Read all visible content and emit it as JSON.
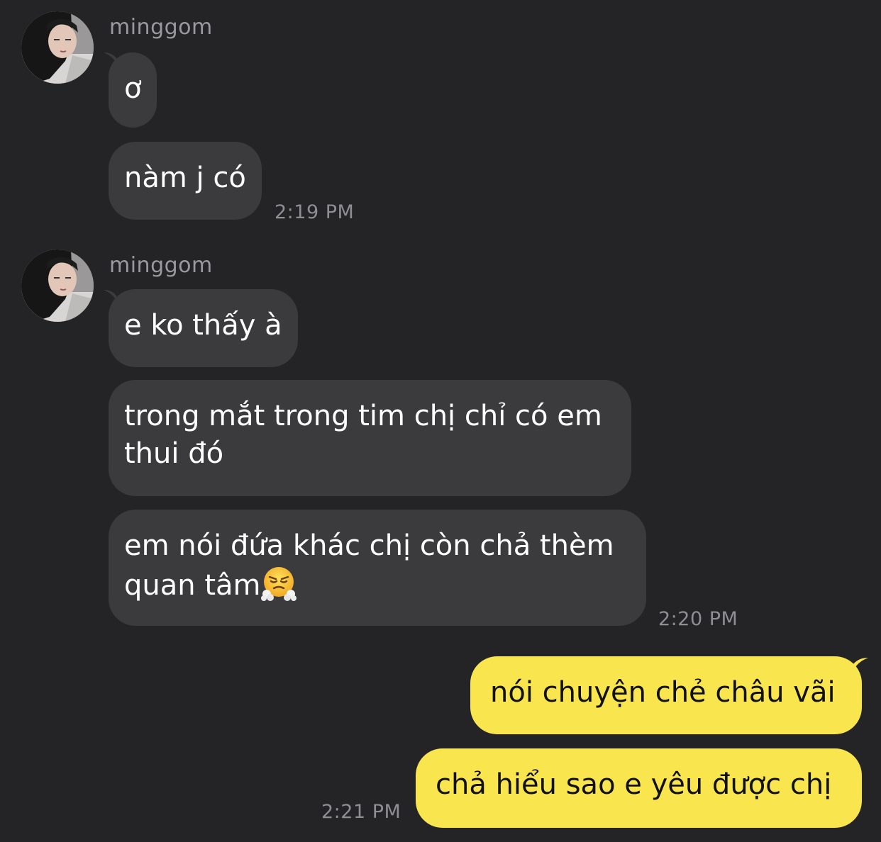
{
  "messages": {
    "group1": {
      "sender": "minggom",
      "bubble1": "ơ",
      "bubble2": "nàm j có",
      "time": "2:19 PM"
    },
    "group2": {
      "sender": "minggom",
      "bubble1": "e ko thấy à",
      "bubble2_line1": "trong mắt trong tim chị chỉ có em",
      "bubble2_line2": "thui đó",
      "bubble3_line1": "em nói đứa khác chị còn chả thèm",
      "bubble3_line2": "quan tâm",
      "bubble3_emoji": "face-with-steam-from-nose-icon",
      "time": "2:20 PM"
    },
    "group3": {
      "bubble1": "nói chuyện chẻ châu vãi",
      "bubble2": "chả hiểu sao e yêu được chị",
      "time": "2:21 PM"
    }
  },
  "colors": {
    "background": "#242426",
    "incoming_bubble": "#3b3b3d",
    "outgoing_bubble": "#f9e54e",
    "sender_text": "#9a9a9e",
    "timestamp_text": "#8e8e93"
  }
}
